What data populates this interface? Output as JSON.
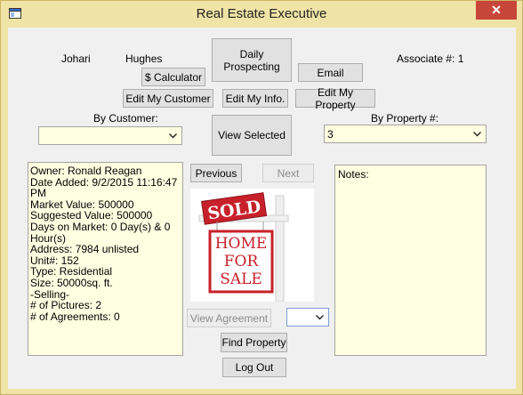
{
  "window": {
    "title": "Real Estate Executive",
    "close_glyph": "✕"
  },
  "header": {
    "first_name": "Johari",
    "last_name": "Hughes",
    "associate": "Associate #: 1"
  },
  "buttons": {
    "daily_prospecting": "Daily Prospecting",
    "calculator": "$ Calculator",
    "email": "Email",
    "edit_customer": "Edit My Customer",
    "edit_info": "Edit My Info.",
    "edit_property": "Edit My Property",
    "view_selected": "View Selected",
    "previous": "Previous",
    "next": "Next",
    "view_agreement": "View Agreement",
    "find_property": "Find Property",
    "log_out": "Log Out"
  },
  "filters": {
    "by_customer_label": "By Customer:",
    "by_customer_value": "",
    "by_property_label": "By Property #:",
    "by_property_value": "3"
  },
  "details": {
    "lines": [
      "Owner: Ronald Reagan",
      "Date Added: 9/2/2015 11:16:47",
      "PM",
      "Market Value: 500000",
      "Suggested Value: 500000",
      "Days on Market: 0 Day(s) & 0",
      "Hour(s)",
      "Address: 7984 unlisted",
      "Unit#: 152",
      "Type: Residential",
      "Size: 50000sq. ft.",
      "-Selling-",
      "# of Pictures: 2",
      "# of Agreements: 0"
    ]
  },
  "notes": {
    "label": "Notes:"
  },
  "agreement_select": {
    "value": ""
  },
  "image": {
    "sold_text": "SOLD",
    "sign_line1": "HOME",
    "sign_line2": "FOR",
    "sign_line3": "SALE",
    "colors": {
      "red": "#c8202a",
      "post": "#e8e8e8"
    }
  },
  "icons": {
    "app": "app-window-icon",
    "close": "close-icon",
    "dropdown": "chevron-down-icon"
  }
}
